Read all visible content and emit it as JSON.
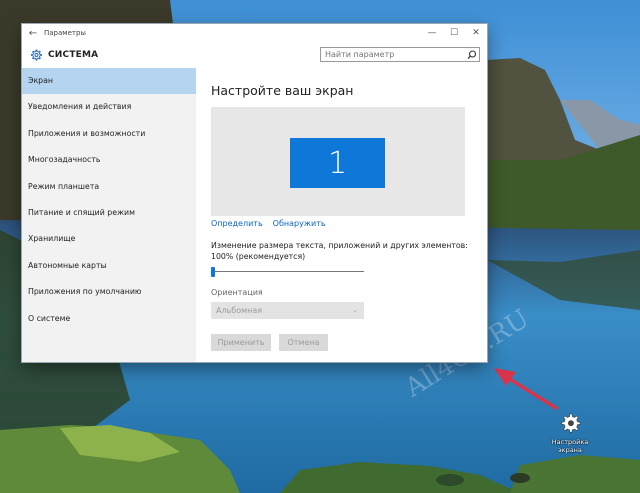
{
  "window": {
    "title": "Параметры",
    "back": "←",
    "minimize": "—",
    "maximize": "☐",
    "close": "✕"
  },
  "header": {
    "section_title": "СИСТЕМА",
    "search_placeholder": "Найти параметр"
  },
  "sidebar": {
    "items": [
      {
        "label": "Экран",
        "active": true
      },
      {
        "label": "Уведомления и действия"
      },
      {
        "label": "Приложения и возможности"
      },
      {
        "label": "Многозадачность"
      },
      {
        "label": "Режим планшета"
      },
      {
        "label": "Питание и спящий режим"
      },
      {
        "label": "Хранилище"
      },
      {
        "label": "Автономные карты"
      },
      {
        "label": "Приложения по умолчанию"
      },
      {
        "label": "О системе"
      }
    ]
  },
  "main": {
    "title": "Настройте ваш экран",
    "monitor_number": "1",
    "identify_link": "Определить",
    "detect_link": "Обнаружить",
    "scale_text": "Изменение размера текста, приложений и других элементов: 100% (рекомендуется)",
    "scale_value_fraction": 0,
    "orientation_label": "Ориентация",
    "orientation_value": "Альбомная",
    "apply_button": "Применить",
    "cancel_button": "Отмена"
  },
  "desktop": {
    "watermark": "All4OS.RU",
    "icon_label": "Настройка экрана",
    "accent_color": "#0d78d7",
    "arrow_color": "#d9354a"
  }
}
